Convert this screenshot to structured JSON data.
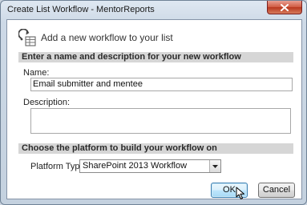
{
  "window": {
    "title": "Create List Workflow - MentorReports"
  },
  "header": {
    "text": "Add a new workflow to your list"
  },
  "section_name": {
    "label": "Enter a name and description for your new workflow"
  },
  "name_field": {
    "label": "Name:",
    "value": "Email submitter and mentee"
  },
  "description_field": {
    "label": "Description:",
    "value": ""
  },
  "section_platform": {
    "label": "Choose the platform to build your workflow on"
  },
  "platform": {
    "label": "Platform Type:",
    "selected": "SharePoint 2013 Workflow"
  },
  "buttons": {
    "ok": "OK",
    "cancel": "Cancel"
  },
  "colors": {
    "close_button": "#c8452a",
    "ok_button_border": "#3c7fb1",
    "section_bar": "#d6d6d6"
  }
}
